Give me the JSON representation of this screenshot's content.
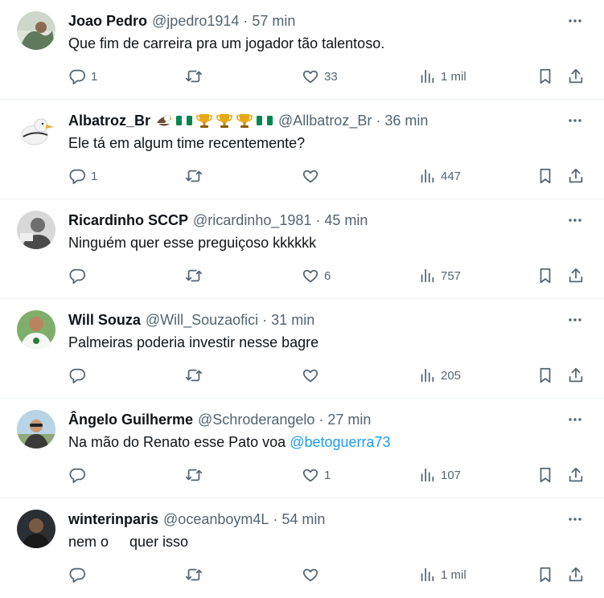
{
  "tweets": [
    {
      "name": "Joao Pedro",
      "emojis": [],
      "handle": "@jpedro1914",
      "separator": "·",
      "time": "57 min",
      "text": "Que fim de carreira pra um jogador tão talentoso.",
      "mention": "",
      "replies": "1",
      "retweets": "",
      "likes": "33",
      "views": "1 mil"
    },
    {
      "name": "Albatroz_Br",
      "emojis": [
        "eagle-emoji",
        "nigeria-flag-emoji",
        "trophy-emoji",
        "trophy-emoji",
        "trophy-emoji",
        "nigeria-flag-emoji"
      ],
      "handle": "@Allbatroz_Br",
      "separator": "·",
      "time": "36 min",
      "text": "Ele tá em algum time recentemente?",
      "mention": "",
      "replies": "1",
      "retweets": "",
      "likes": "",
      "views": "447"
    },
    {
      "name": "Ricardinho SCCP",
      "emojis": [],
      "handle": "@ricardinho_1981",
      "separator": "·",
      "time": "45 min",
      "text": "Ninguém quer esse preguiçoso kkkkkk",
      "mention": "",
      "replies": "",
      "retweets": "",
      "likes": "6",
      "views": "757"
    },
    {
      "name": "Will Souza",
      "emojis": [],
      "handle": "@Will_Souzaofici",
      "separator": "·",
      "time": "31 min",
      "text": "Palmeiras poderia investir nesse bagre",
      "mention": "",
      "replies": "",
      "retweets": "",
      "likes": "",
      "views": "205"
    },
    {
      "name": "Ângelo Guilherme",
      "emojis": [],
      "handle": "@Schroderangelo",
      "separator": "·",
      "time": "27 min",
      "text": "Na mão do Renato esse Pato voa",
      "mention": "@betoguerra73",
      "replies": "",
      "retweets": "",
      "likes": "1",
      "views": "107"
    },
    {
      "name": "winterinparis",
      "emojis": [],
      "handle": "@oceanboym4L",
      "separator": "·",
      "time": "54 min",
      "text": "nem o",
      "text_after": "quer isso",
      "mention": "",
      "replies": "",
      "retweets": "",
      "likes": "",
      "views": "1 mil"
    }
  ],
  "colors": {
    "text": "#0f1419",
    "secondary": "#536471",
    "link": "#1d9bf0",
    "divider": "#eff3f4"
  },
  "icons": {
    "more": "more-dots-icon",
    "reply": "reply-icon",
    "retweet": "retweet-icon",
    "like": "heart-icon",
    "views": "views-bar-chart-icon",
    "bookmark": "bookmark-icon",
    "share": "share-upload-icon"
  }
}
